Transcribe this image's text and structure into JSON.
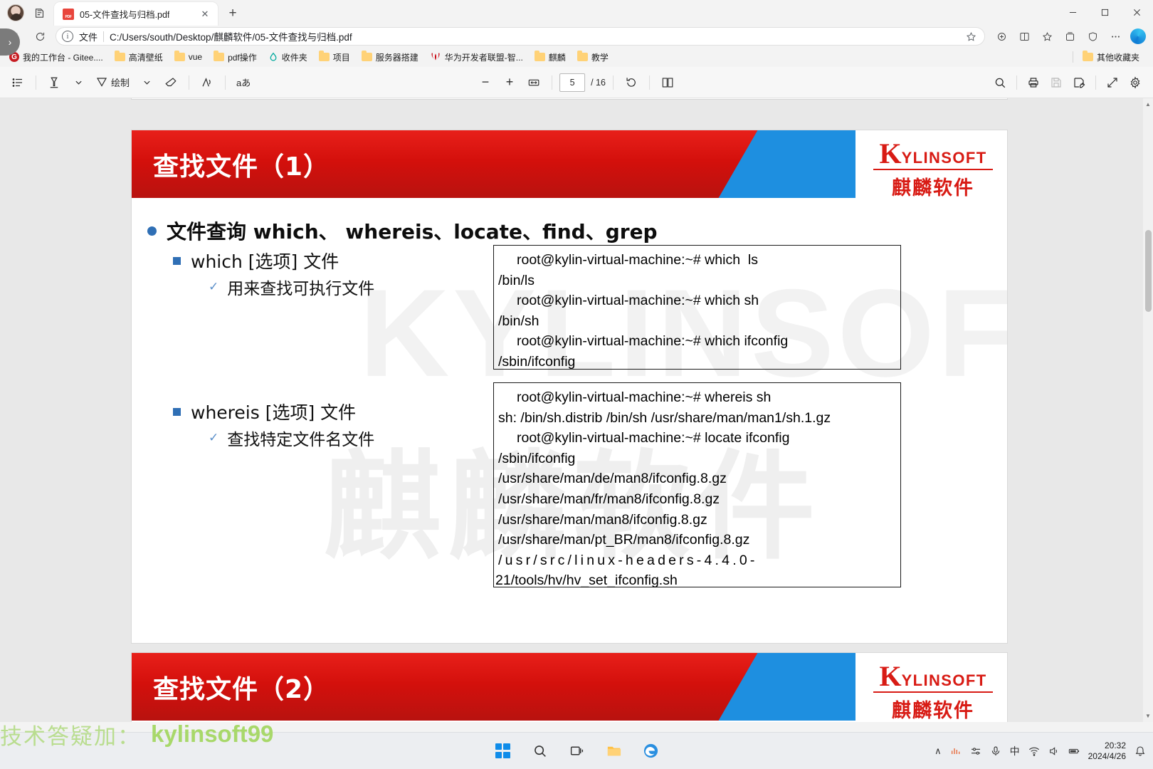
{
  "browser": {
    "tab": {
      "title": "05-文件查找与归档.pdf",
      "favicon": "pdf-icon",
      "close": "✕"
    },
    "newtab_label": "+",
    "window_controls": {
      "minimize": "minimize-icon",
      "maximize": "maximize-icon",
      "close": "close-icon"
    },
    "nav": {
      "back": "◀",
      "reload": "reload-icon",
      "scheme_label": "文件",
      "url": "C:/Users/south/Desktop/麒麟软件/05-文件查找与归档.pdf",
      "star": "favorite-icon"
    },
    "bookmarks": [
      {
        "label": "我的工作台 - Gitee....",
        "icon": "gitee-icon"
      },
      {
        "label": "高清壁纸",
        "icon": "folder-icon"
      },
      {
        "label": "vue",
        "icon": "folder-icon"
      },
      {
        "label": "pdf操作",
        "icon": "folder-icon"
      },
      {
        "label": "收件夹",
        "icon": "drop-icon"
      },
      {
        "label": "项目",
        "icon": "folder-icon"
      },
      {
        "label": "服务器搭建",
        "icon": "folder-icon"
      },
      {
        "label": "华为开发者联盟-智...",
        "icon": "huawei-icon"
      },
      {
        "label": "麒麟",
        "icon": "folder-icon"
      },
      {
        "label": "教学",
        "icon": "folder-icon"
      }
    ],
    "bookmarks_overflow": {
      "label": "其他收藏夹",
      "icon": "folder-icon"
    }
  },
  "pdf_toolbar": {
    "left": [
      {
        "name": "toc-icon",
        "label": ""
      },
      {
        "name": "highlight-icon",
        "label": ""
      },
      {
        "name": "chevron-down-icon",
        "label": ""
      },
      {
        "name": "draw-icon",
        "label": "绘制"
      },
      {
        "name": "chevron-down-icon",
        "label": ""
      },
      {
        "name": "eraser-icon",
        "label": ""
      },
      {
        "name": "read-aloud-icon",
        "label": ""
      },
      {
        "name": "translate-icon",
        "label": "aあ"
      }
    ],
    "zoom_out": "−",
    "zoom_in": "+",
    "fit_page": "fit-page-icon",
    "page_current": "5",
    "page_total": "/ 16",
    "rotate": "rotate-icon",
    "layout": "page-layout-icon",
    "right": [
      {
        "name": "search-icon"
      },
      {
        "name": "print-icon"
      },
      {
        "name": "save-icon"
      },
      {
        "name": "save-as-icon"
      },
      {
        "name": "fullscreen-icon"
      },
      {
        "name": "settings-icon"
      }
    ]
  },
  "slide": {
    "title": "查找文件（1）",
    "logo": {
      "k": "K",
      "word": "YLINSOFT",
      "cn": "麒麟软件"
    },
    "watermark_1": "KYLINSOFT",
    "watermark_2": "麒麟软件",
    "bullet_main": "文件查询 which、 whereis、locate、find、grep",
    "items": [
      {
        "level2": "which [选项] 文件",
        "level3": "用来查找可执行文件"
      },
      {
        "level2": "whereis [选项] 文件",
        "level3": "查找特定文件名文件"
      }
    ],
    "terminal_1": [
      "root@kylin-virtual-machine:~# which  ls",
      "/bin/ls",
      "root@kylin-virtual-machine:~# which sh",
      "/bin/sh",
      "root@kylin-virtual-machine:~# which ifconfig",
      "/sbin/ifconfig"
    ],
    "terminal_2": [
      "root@kylin-virtual-machine:~# whereis sh",
      "sh: /bin/sh.distrib /bin/sh /usr/share/man/man1/sh.1.gz",
      "root@kylin-virtual-machine:~# locate ifconfig",
      "/sbin/ifconfig",
      "/usr/share/man/de/man8/ifconfig.8.gz",
      "/usr/share/man/fr/man8/ifconfig.8.gz",
      "/usr/share/man/man8/ifconfig.8.gz",
      "/usr/share/man/pt_BR/man8/ifconfig.8.gz"
    ],
    "terminal_2_spaced": "/usr/src/linux-headers-4.4.0-",
    "terminal_2_last": "21/tools/hv/hv_set_ifconfig.sh",
    "next_slide_title": "查找文件（2）"
  },
  "overlay_watermark": {
    "cn": "技术答疑加：",
    "en": "kylinsoft99"
  },
  "taskbar": {
    "items": [
      {
        "name": "start-button"
      },
      {
        "name": "search-button"
      },
      {
        "name": "task-view-button"
      },
      {
        "name": "file-explorer-button"
      },
      {
        "name": "edge-browser-button"
      }
    ],
    "tray": [
      {
        "name": "tray-expand-icon",
        "glyph": "∧"
      },
      {
        "name": "network-monitor-icon"
      },
      {
        "name": "sound-mixer-icon"
      },
      {
        "name": "microphone-icon"
      },
      {
        "name": "ime-indicator",
        "glyph": "中"
      },
      {
        "name": "wifi-icon"
      },
      {
        "name": "volume-icon"
      },
      {
        "name": "battery-icon"
      }
    ],
    "clock_time": "20:32",
    "clock_date": "2024/4/26"
  }
}
